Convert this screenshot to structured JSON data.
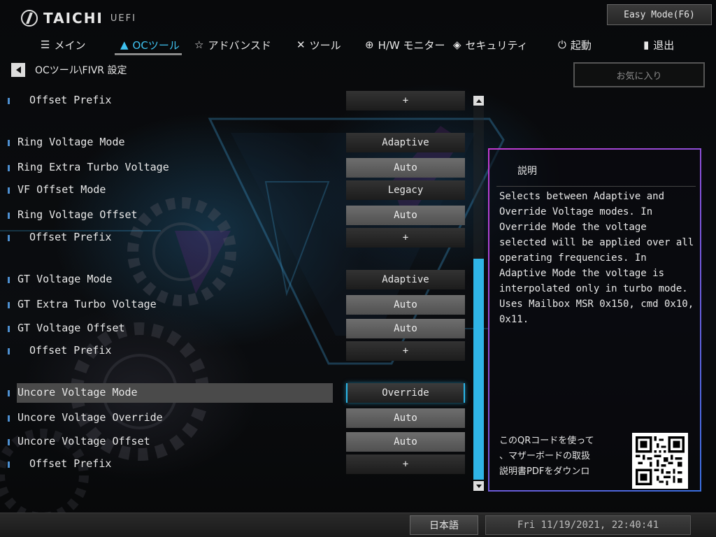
{
  "header": {
    "logo_text": "TAICHI",
    "logo_sub": "UEFI",
    "easy_mode_label": "Easy Mode(F6)"
  },
  "nav": {
    "items": [
      {
        "label": "メイン",
        "icon": "list-icon"
      },
      {
        "label": "OCツール",
        "icon": "rocket-icon",
        "active": true
      },
      {
        "label": "アドバンスド",
        "icon": "star-icon"
      },
      {
        "label": "ツール",
        "icon": "tools-icon"
      },
      {
        "label": "H/W モニター",
        "icon": "crosshair-icon"
      },
      {
        "label": "セキュリティ",
        "icon": "shield-icon"
      },
      {
        "label": "起動",
        "icon": "power-icon"
      },
      {
        "label": "退出",
        "icon": "exit-door-icon"
      }
    ]
  },
  "breadcrumb": "OCツール\\FIVR 設定",
  "favorites_label": "お気に入り",
  "settings": [
    {
      "label": "Offset Prefix",
      "value": "+",
      "sub": true,
      "style": "dark"
    },
    {
      "label": "Ring Voltage Mode",
      "value": "Adaptive",
      "sub": false,
      "style": "dark"
    },
    {
      "label": "Ring Extra Turbo Voltage",
      "value": "Auto",
      "sub": false,
      "style": "light"
    },
    {
      "label": "VF Offset Mode",
      "value": "Legacy",
      "sub": false,
      "style": "dark"
    },
    {
      "label": "Ring Voltage Offset",
      "value": "Auto",
      "sub": false,
      "style": "light"
    },
    {
      "label": "Offset Prefix",
      "value": "+",
      "sub": true,
      "style": "dark"
    },
    {
      "label": "GT Voltage Mode",
      "value": "Adaptive",
      "sub": false,
      "style": "dark"
    },
    {
      "label": "GT Extra Turbo Voltage",
      "value": "Auto",
      "sub": false,
      "style": "light"
    },
    {
      "label": "GT Voltage Offset",
      "value": "Auto",
      "sub": false,
      "style": "light"
    },
    {
      "label": "Offset Prefix",
      "value": "+",
      "sub": true,
      "style": "dark"
    },
    {
      "label": "Uncore Voltage Mode",
      "value": "Override",
      "sub": false,
      "style": "selected"
    },
    {
      "label": "Uncore Voltage Override",
      "value": "Auto",
      "sub": false,
      "style": "light"
    },
    {
      "label": "Uncore Voltage Offset",
      "value": "Auto",
      "sub": false,
      "style": "light"
    },
    {
      "label": "Offset Prefix",
      "value": "+",
      "sub": true,
      "style": "dark"
    }
  ],
  "description": {
    "title": "説明",
    "body": "Selects between Adaptive and\nOverride Voltage modes. In\nOverride Mode the voltage\nselected will be applied over all\noperating frequencies. In\nAdaptive Mode the voltage is\ninterpolated only in turbo mode.\nUses Mailbox MSR 0x150, cmd 0x10,\n0x11.",
    "qr_text": "このQRコードを使って\n、マザーボードの取扱\n説明書PDFをダウンロ"
  },
  "footer": {
    "language": "日本語",
    "datetime": "Fri 11/19/2021, 22:40:41"
  },
  "colors": {
    "accent": "#2fb4e6",
    "panel_border_start": "#c23ad0",
    "panel_border_end": "#3a6fe0"
  }
}
